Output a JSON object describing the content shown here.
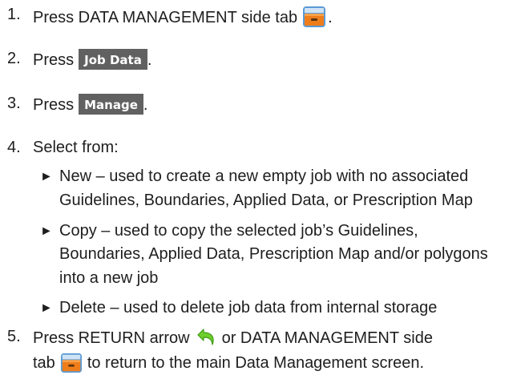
{
  "steps": {
    "s1": {
      "num": "1.",
      "text": "Press DATA MANAGEMENT side tab",
      "icon": "data-management-tab-icon",
      "end": "."
    },
    "s2": {
      "num": "2.",
      "pre": "Press",
      "chip": "Job Data",
      "end": "."
    },
    "s3": {
      "num": "3.",
      "pre": "Press",
      "chip": "Manage",
      "end": "."
    },
    "s4": {
      "num": "4.",
      "text": "Select from:"
    },
    "s5": {
      "num": "5.",
      "pre": "Press RETURN arrow",
      "mid": "or DATA MANAGEMENT side",
      "tab": "tab",
      "post": "to return to the main Data Management screen.",
      "return_icon": "return-arrow-icon",
      "tab_icon": "data-management-tab-icon"
    }
  },
  "options": [
    {
      "marker": "►",
      "lines": [
        "New – used to create a new empty job with no associated",
        "Guidelines, Boundaries, Applied Data, or Prescription Map"
      ]
    },
    {
      "marker": "►",
      "lines": [
        "Copy – used to copy the selected job’s Guidelines,",
        "Boundaries, Applied Data, Prescription Map and/or polygons",
        "into a new job"
      ]
    },
    {
      "marker": "►",
      "lines": [
        "Delete – used to delete job data from internal storage"
      ]
    }
  ],
  "colors": {
    "chip_bg": "#616161",
    "chip_text": "#ffffff",
    "icon_orange": "#ef7d1a",
    "arrow_green": "#6fcf2a"
  }
}
